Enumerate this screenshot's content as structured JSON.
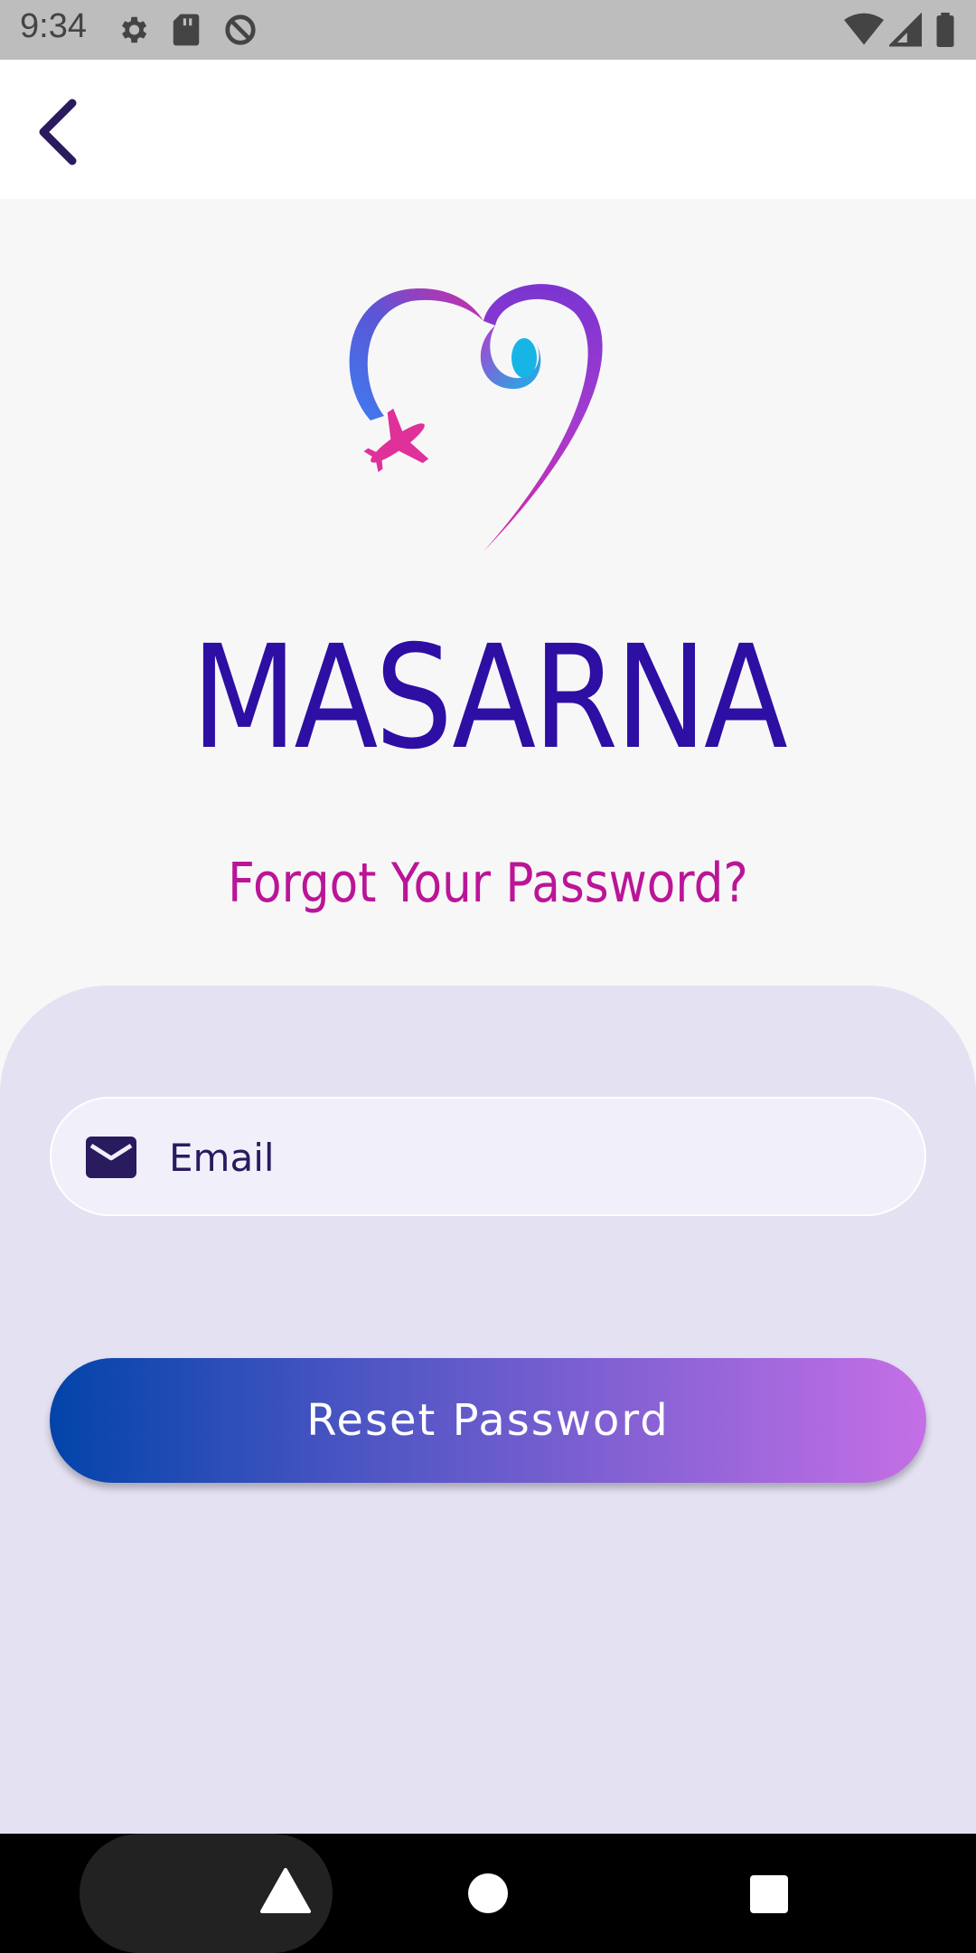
{
  "status_bar": {
    "time": "9:34",
    "icons": [
      "gear-icon",
      "sd-card-icon",
      "sync-disabled-icon",
      "wifi-icon",
      "cell-signal-icon",
      "battery-icon"
    ]
  },
  "app_bar": {
    "back_icon": "chevron-left-icon"
  },
  "logo": {
    "brand_name": "MASARNA",
    "icon": "heart-airplane-logo"
  },
  "forgot_title": "Forgot Your Password?",
  "form": {
    "email_placeholder": "Email",
    "email_value": "",
    "email_icon": "mail-icon",
    "reset_label": "Reset Password"
  },
  "colors": {
    "brand": "#2d0fa3",
    "accent": "#bb1597",
    "card": "#e4e1f2",
    "button_start": "#0244aa",
    "button_end": "#c56fe6"
  },
  "nav_bar": {
    "icons": [
      "back-triangle-icon",
      "home-circle-icon",
      "recents-square-icon"
    ]
  }
}
